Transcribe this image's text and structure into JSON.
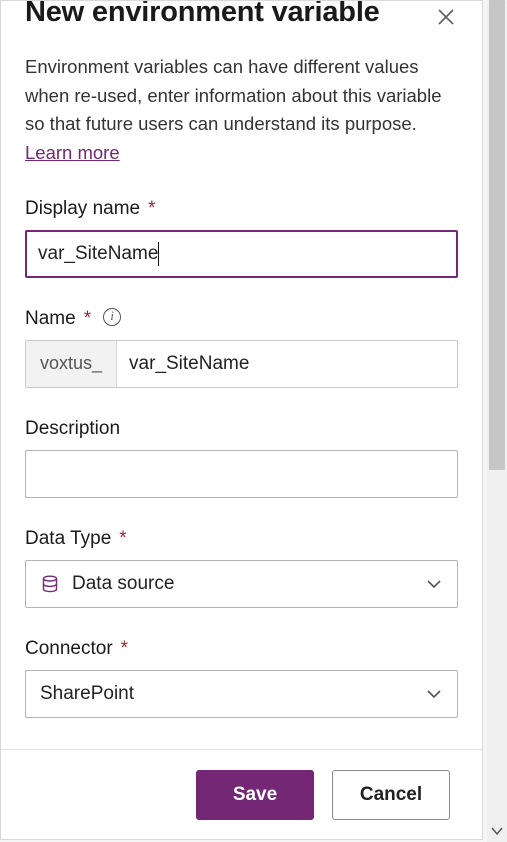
{
  "panel": {
    "title": "New environment variable",
    "intro": "Environment variables can have different values when re-used, enter information about this variable so that future users can understand its purpose. ",
    "learn_more": "Learn more"
  },
  "fields": {
    "display_name": {
      "label": "Display name",
      "value": "var_SiteName"
    },
    "name": {
      "label": "Name",
      "prefix": "voxtus_",
      "value": "var_SiteName"
    },
    "description": {
      "label": "Description",
      "value": ""
    },
    "data_type": {
      "label": "Data Type",
      "value": "Data source",
      "icon": "database-icon"
    },
    "connector": {
      "label": "Connector",
      "value": "SharePoint"
    }
  },
  "footer": {
    "save": "Save",
    "cancel": "Cancel"
  },
  "required_marker": "*"
}
